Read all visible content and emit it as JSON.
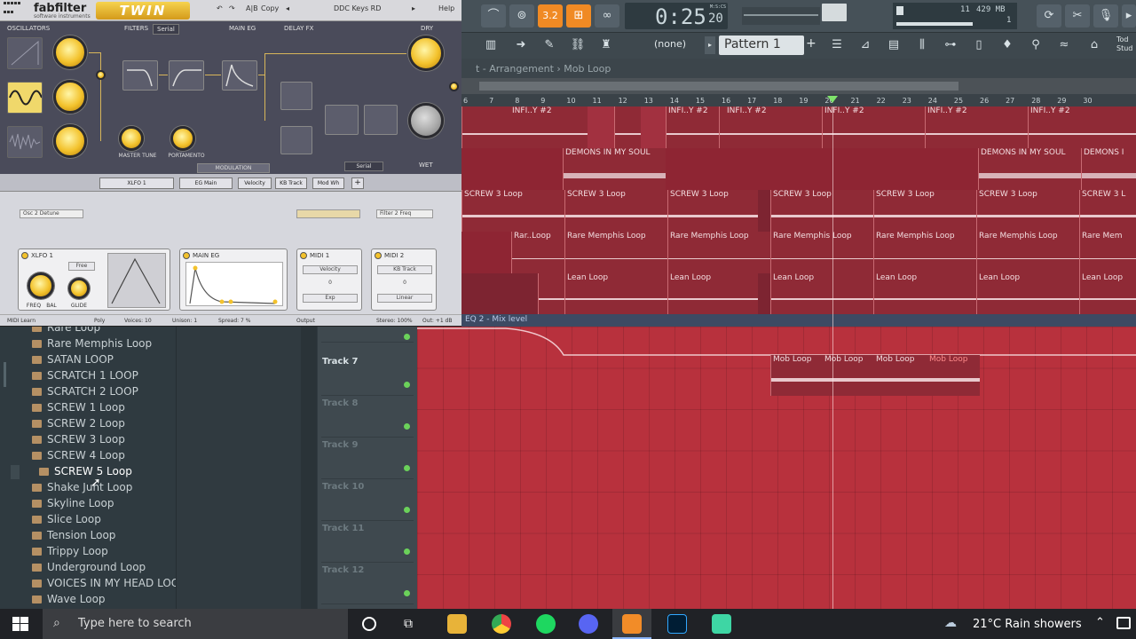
{
  "synth": {
    "brand": "fabfilter",
    "brand_sub": "software instruments",
    "product": "TWIN",
    "top": {
      "copy": "Copy",
      "ab": "A|B",
      "preset": "DDC Keys RD",
      "help": "Help"
    },
    "sections": {
      "oscillators": "OSCILLATORS",
      "filters": "FILTERS",
      "filters_mode": "Serial",
      "main_eg": "MAIN EG",
      "delay_fx": "DELAY FX",
      "dry": "DRY",
      "wet": "WET",
      "serial": "Serial"
    },
    "knobs": {
      "master_tune": "MASTER TUNE",
      "portamento": "PORTAMENTO",
      "modulation": "MODULATION"
    },
    "mod_tabs": [
      "XLFO 1",
      "EG Main",
      "Velocity",
      "KB Track",
      "Mod Wh"
    ],
    "slots": [
      "Osc 2 Detune",
      "Filter 2 Freq"
    ],
    "panels": {
      "xlfo": "XLFO 1",
      "xlfo_mode": "Free",
      "freq": "FREQ",
      "bal": "BAL",
      "glide": "GLIDE",
      "main_eg": "MAIN EG",
      "midi1": "MIDI 1",
      "midi1_sel": "Velocity",
      "midi1_val": "0",
      "midi1_curve": "Exp",
      "midi2": "MIDI 2",
      "midi2_sel": "KB Track",
      "midi2_val": "0",
      "midi2_curve": "Linear"
    },
    "status": {
      "midi_learn": "MIDI Learn",
      "poly": "Poly",
      "voices": "Voices: 10",
      "unison": "Unison: 1",
      "spread": "Spread: 7 %",
      "output": "Output",
      "stereo": "Stereo: 100%",
      "out": "Out: +1 dB"
    }
  },
  "toolbar": {
    "tempo": "3.2",
    "time": "0:25",
    "time_frames": "20",
    "time_unit": "M:S:CS",
    "cpu": "11",
    "mem": "429 MB",
    "poly": "1",
    "pattern": "Pattern 1",
    "none": "(none)",
    "today": "Tod Stud"
  },
  "playlist": {
    "breadcrumb": "t - Arrangement › Mob Loop",
    "automation": "EQ 2 - Mix level",
    "ruler": [
      "6",
      "7",
      "8",
      "9",
      "10",
      "11",
      "12",
      "13",
      "14",
      "15",
      "16",
      "17",
      "18",
      "19",
      "20",
      "21",
      "22",
      "23",
      "24",
      "25",
      "26",
      "27",
      "28",
      "29",
      "30"
    ],
    "clip_names": {
      "infinity": "INFI..Y #2",
      "demons": "DEMONS IN MY SOUL",
      "demons_short": "DEMONS I",
      "screw": "SCREW 3 Loop",
      "screw_short": "SCREW 3 L",
      "rare": "Rare Memphis Loop",
      "rare_short": "Rar..Loop",
      "rare_tail": "Rare Mem",
      "lean": "Lean Loop",
      "mob": "Mob Loop"
    },
    "tracks": [
      "Track 7",
      "Track 8",
      "Track 9",
      "Track 10",
      "Track 11",
      "Track 12"
    ]
  },
  "browser": {
    "items": [
      "Rare Loop",
      "Rare Memphis Loop",
      "SATAN LOOP",
      "SCRATCH 1 LOOP",
      "SCRATCH 2 LOOP",
      "SCREW 1 Loop",
      "SCREW 2 Loop",
      "SCREW 3 Loop",
      "SCREW 4 Loop",
      "SCREW 5 Loop",
      "Shake Junt Loop",
      "Skyline Loop",
      "Slice Loop",
      "Tension Loop",
      "Trippy Loop",
      "Underground Loop",
      "VOICES IN MY HEAD LOOP",
      "Wave Loop"
    ]
  },
  "taskbar": {
    "search_placeholder": "Type here to search",
    "weather": "21°C  Rain showers"
  }
}
